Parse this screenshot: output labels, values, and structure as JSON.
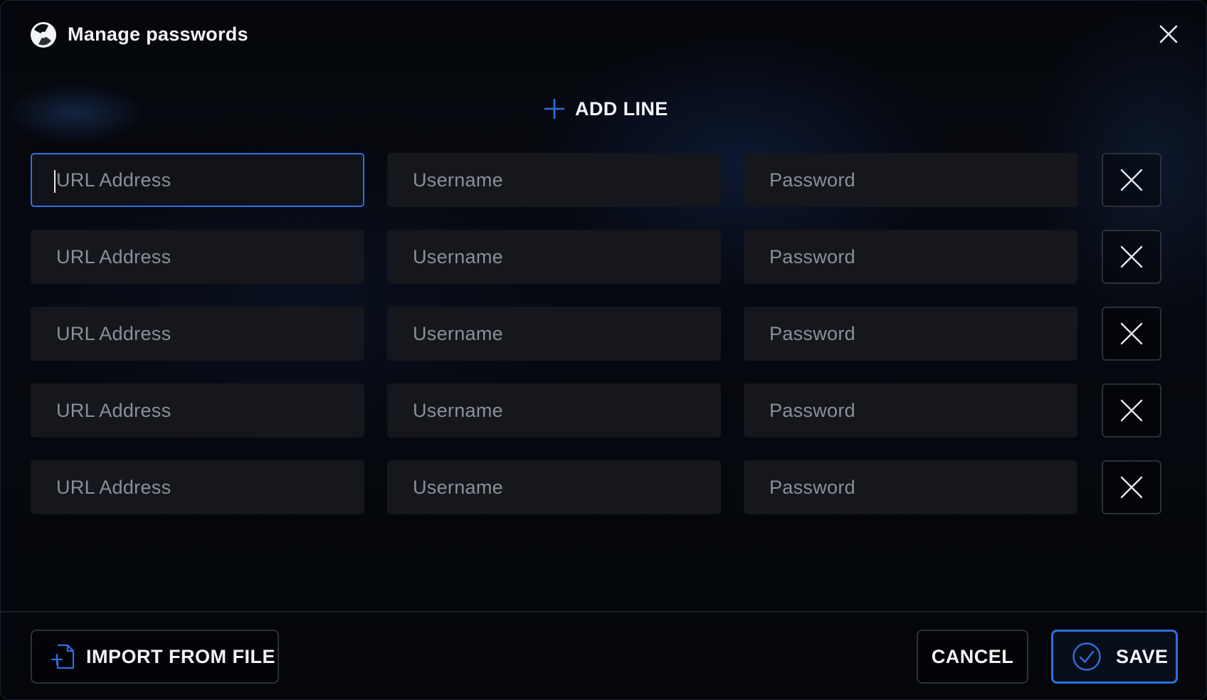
{
  "dialog": {
    "title": "Manage passwords",
    "logo_icon": "app-logo-icon",
    "close_icon": "close-icon"
  },
  "add_line": {
    "label": "ADD LINE",
    "icon": "plus-icon",
    "accent_color": "#2f6fe0"
  },
  "rows": [
    {
      "url_placeholder": "URL Address",
      "username_placeholder": "Username",
      "password_placeholder": "Password",
      "url": "",
      "username": "",
      "password": "",
      "focused": "url"
    },
    {
      "url_placeholder": "URL Address",
      "username_placeholder": "Username",
      "password_placeholder": "Password",
      "url": "",
      "username": "",
      "password": ""
    },
    {
      "url_placeholder": "URL Address",
      "username_placeholder": "Username",
      "password_placeholder": "Password",
      "url": "",
      "username": "",
      "password": ""
    },
    {
      "url_placeholder": "URL Address",
      "username_placeholder": "Username",
      "password_placeholder": "Password",
      "url": "",
      "username": "",
      "password": ""
    },
    {
      "url_placeholder": "URL Address",
      "username_placeholder": "Username",
      "password_placeholder": "Password",
      "url": "",
      "username": "",
      "password": ""
    }
  ],
  "row_remove_icon": "x-icon",
  "footer": {
    "import_label": "IMPORT FROM FILE",
    "import_icon": "file-import-icon",
    "cancel_label": "CANCEL",
    "save_label": "SAVE",
    "save_icon": "check-circle-icon"
  },
  "colors": {
    "accent": "#2f6fe0",
    "field_bg": "#15171c",
    "placeholder": "#8b8f97",
    "text": "#f2f4f8"
  }
}
